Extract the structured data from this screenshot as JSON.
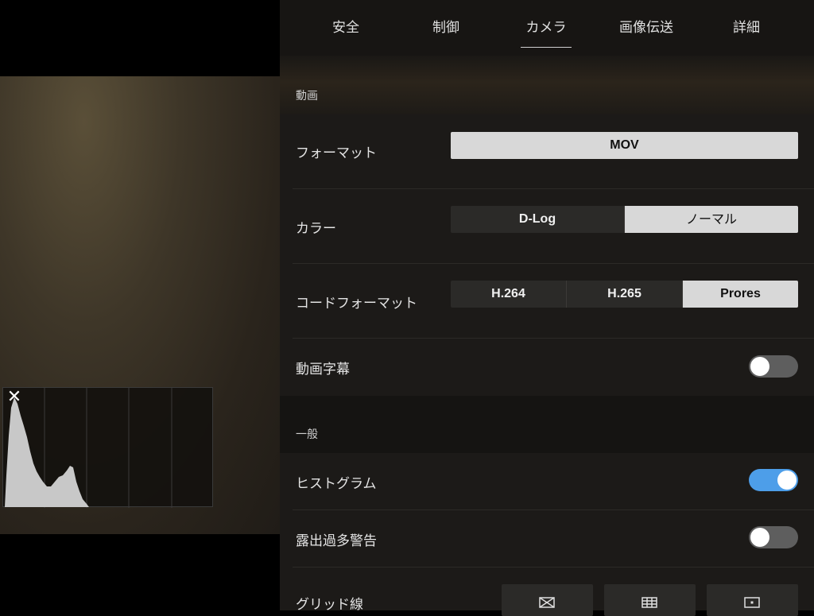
{
  "tabs": [
    {
      "label": "安全"
    },
    {
      "label": "制御"
    },
    {
      "label": "カメラ",
      "active": true
    },
    {
      "label": "画像伝送"
    },
    {
      "label": "詳細"
    }
  ],
  "sections": {
    "video": "動画",
    "general": "一般"
  },
  "settings": {
    "format": {
      "label": "フォーマット",
      "options": [
        "MOV"
      ],
      "selected": "MOV"
    },
    "color": {
      "label": "カラー",
      "options": [
        "D-Log",
        "ノーマル"
      ],
      "selected": "ノーマル"
    },
    "codec": {
      "label": "コードフォーマット",
      "options": [
        "H.264",
        "H.265",
        "Prores"
      ],
      "selected": "Prores"
    },
    "subtitle": {
      "label": "動画字幕",
      "on": false
    },
    "histogram": {
      "label": "ヒストグラム",
      "on": true
    },
    "overexposure": {
      "label": "露出過多警告",
      "on": false
    },
    "gridlines": {
      "label": "グリッド線",
      "icons": [
        "diagonal-grid-icon",
        "grid-icon",
        "center-point-icon"
      ]
    }
  },
  "histogram_panel": {
    "close_icon": "close-icon"
  },
  "colors": {
    "toggle_on": "#4d9ee9",
    "toggle_off": "#5e5e5e",
    "selected_segment": "#d8d8d8"
  }
}
